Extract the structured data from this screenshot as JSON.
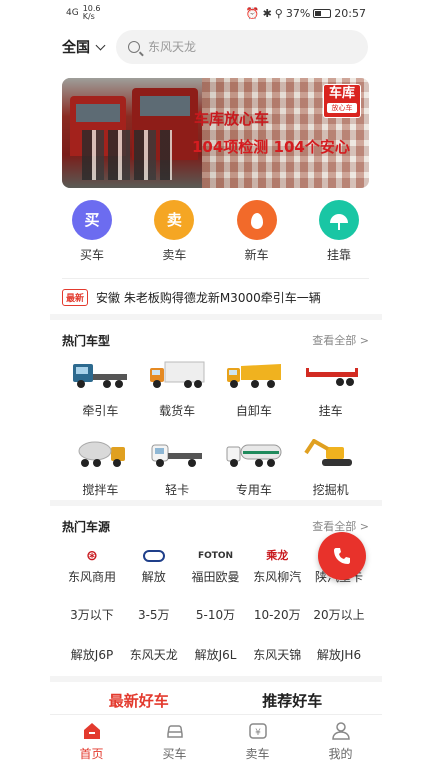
{
  "status_bar": {
    "signal": "4G",
    "netspeed_value": "10.6",
    "netspeed_unit": "K/s",
    "battery": "37%",
    "time": "20:57"
  },
  "header": {
    "region": "全国",
    "search_placeholder": "东风天龙"
  },
  "banner": {
    "headline": "车库放心车",
    "subline": "104项检测  104个安心",
    "logo_top": "车库",
    "logo_bottom": "放心车"
  },
  "quick_actions": [
    {
      "label": "买车",
      "glyph": "买",
      "color": "#6c6cf0"
    },
    {
      "label": "卖车",
      "glyph": "卖",
      "color": "#f5a623"
    },
    {
      "label": "新车",
      "color": "#f26a2a"
    },
    {
      "label": "挂靠",
      "color": "#19c6a4"
    }
  ],
  "news": {
    "badge": "最新",
    "text": "安徽 朱老板购得德龙新M3000牵引车一辆"
  },
  "hot_types": {
    "title": "热门车型",
    "more": "查看全部 >",
    "items": [
      "牵引车",
      "载货车",
      "自卸车",
      "挂车",
      "搅拌车",
      "轻卡",
      "专用车",
      "挖掘机"
    ]
  },
  "hot_sources": {
    "title": "热门车源",
    "more": "查看全部 >",
    "brands": [
      "东风商用",
      "解放",
      "福田欧曼",
      "东风柳汽",
      "陕汽重卡"
    ],
    "brand_logos": [
      "",
      "",
      "FOTON",
      "乘龙",
      ""
    ],
    "prices": [
      "3万以下",
      "3-5万",
      "5-10万",
      "10-20万",
      "20万以上"
    ],
    "models": [
      "解放J6P",
      "东风天龙",
      "解放J6L",
      "东风天锦",
      "解放JH6"
    ]
  },
  "feed_tabs": [
    "最新好车",
    "推荐好车"
  ],
  "bottom_nav": [
    "首页",
    "买车",
    "卖车",
    "我的"
  ],
  "colors": {
    "accent": "#e33a2e"
  }
}
